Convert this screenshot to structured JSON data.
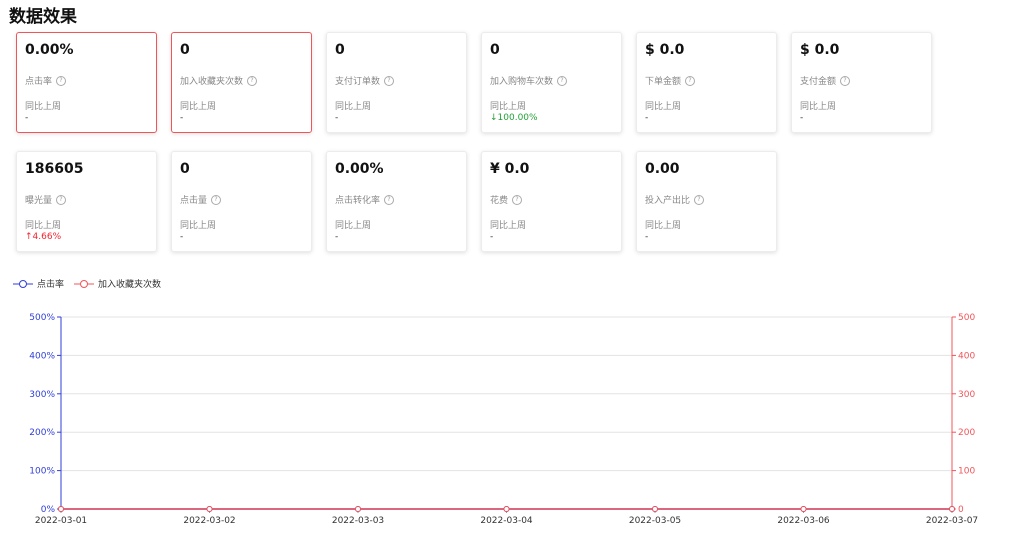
{
  "page_title": "数据效果",
  "compare_label": "同比上周",
  "cards_row1": [
    {
      "value": "0.00%",
      "label": "点击率",
      "compare": "-",
      "trend": "none",
      "selected": true
    },
    {
      "value": "0",
      "label": "加入收藏夹次数",
      "compare": "-",
      "trend": "none",
      "selected": true
    },
    {
      "value": "0",
      "label": "支付订单数",
      "compare": "-",
      "trend": "none",
      "selected": false
    },
    {
      "value": "0",
      "label": "加入购物车次数",
      "compare": "↓100.00%",
      "trend": "down",
      "selected": false
    },
    {
      "value": "$ 0.0",
      "label": "下单金额",
      "compare": "-",
      "trend": "none",
      "selected": false
    },
    {
      "value": "$ 0.0",
      "label": "支付金额",
      "compare": "-",
      "trend": "none",
      "selected": false
    }
  ],
  "cards_row2": [
    {
      "value": "186605",
      "label": "曝光量",
      "compare": "↑4.66%",
      "trend": "up",
      "selected": false
    },
    {
      "value": "0",
      "label": "点击量",
      "compare": "-",
      "trend": "none",
      "selected": false
    },
    {
      "value": "0.00%",
      "label": "点击转化率",
      "compare": "-",
      "trend": "none",
      "selected": false
    },
    {
      "value": "¥ 0.0",
      "label": "花费",
      "compare": "-",
      "trend": "none",
      "selected": false
    },
    {
      "value": "0.00",
      "label": "投入产出比",
      "compare": "-",
      "trend": "none",
      "selected": false
    }
  ],
  "colors": {
    "series_left": "#2f3fd8",
    "series_right": "#f0555a",
    "up": "#f5222d",
    "down": "#21a336"
  },
  "chart_data": {
    "type": "line",
    "x": [
      "2022-03-01",
      "2022-03-02",
      "2022-03-03",
      "2022-03-04",
      "2022-03-05",
      "2022-03-06",
      "2022-03-07"
    ],
    "series": [
      {
        "name": "点击率",
        "axis": "left",
        "values": [
          0,
          0,
          0,
          0,
          0,
          0,
          0
        ]
      },
      {
        "name": "加入收藏夹次数",
        "axis": "right",
        "values": [
          0,
          0,
          0,
          0,
          0,
          0,
          0
        ]
      }
    ],
    "y_left": {
      "ticks": [
        "0%",
        "100%",
        "200%",
        "300%",
        "400%",
        "500%"
      ],
      "range": [
        0,
        500
      ]
    },
    "y_right": {
      "ticks": [
        "0",
        "100",
        "200",
        "300",
        "400",
        "500"
      ],
      "range": [
        0,
        500
      ]
    },
    "grid": true,
    "legend": "top-left"
  }
}
